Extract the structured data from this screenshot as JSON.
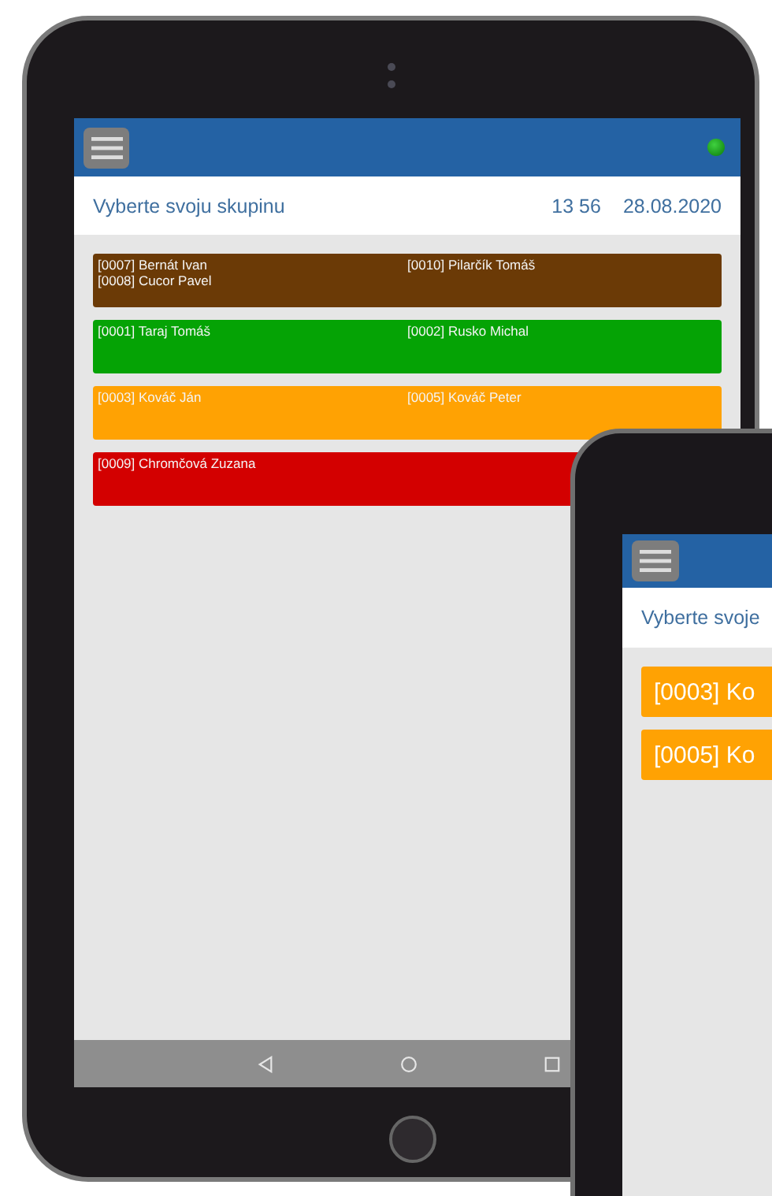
{
  "main_screen": {
    "title": "Vyberte svoju skupinu",
    "time": "13 56",
    "date": "28.08.2020",
    "groups": [
      {
        "color": "#6b3a06",
        "columns": [
          [
            "[0007] Bernát Ivan",
            "[0008] Cucor Pavel"
          ],
          [
            "[0010] Pilarčík Tomáš"
          ]
        ]
      },
      {
        "color": "#05a305",
        "columns": [
          [
            "[0001] Taraj Tomáš"
          ],
          [
            "[0002] Rusko Michal"
          ]
        ]
      },
      {
        "color": "#ffa203",
        "columns": [
          [
            "[0003] Kováč Ján"
          ],
          [
            "[0005] Kováč Peter"
          ]
        ]
      },
      {
        "color": "#d30000",
        "columns": [
          [
            "[0009] Chromčová Zuzana"
          ]
        ]
      }
    ]
  },
  "second_screen": {
    "title": "Vyberte svoje",
    "items": [
      {
        "label": "[0003] Ko",
        "color": "#ffa203"
      },
      {
        "label": "[0005] Ko",
        "color": "#ffa203"
      }
    ]
  }
}
